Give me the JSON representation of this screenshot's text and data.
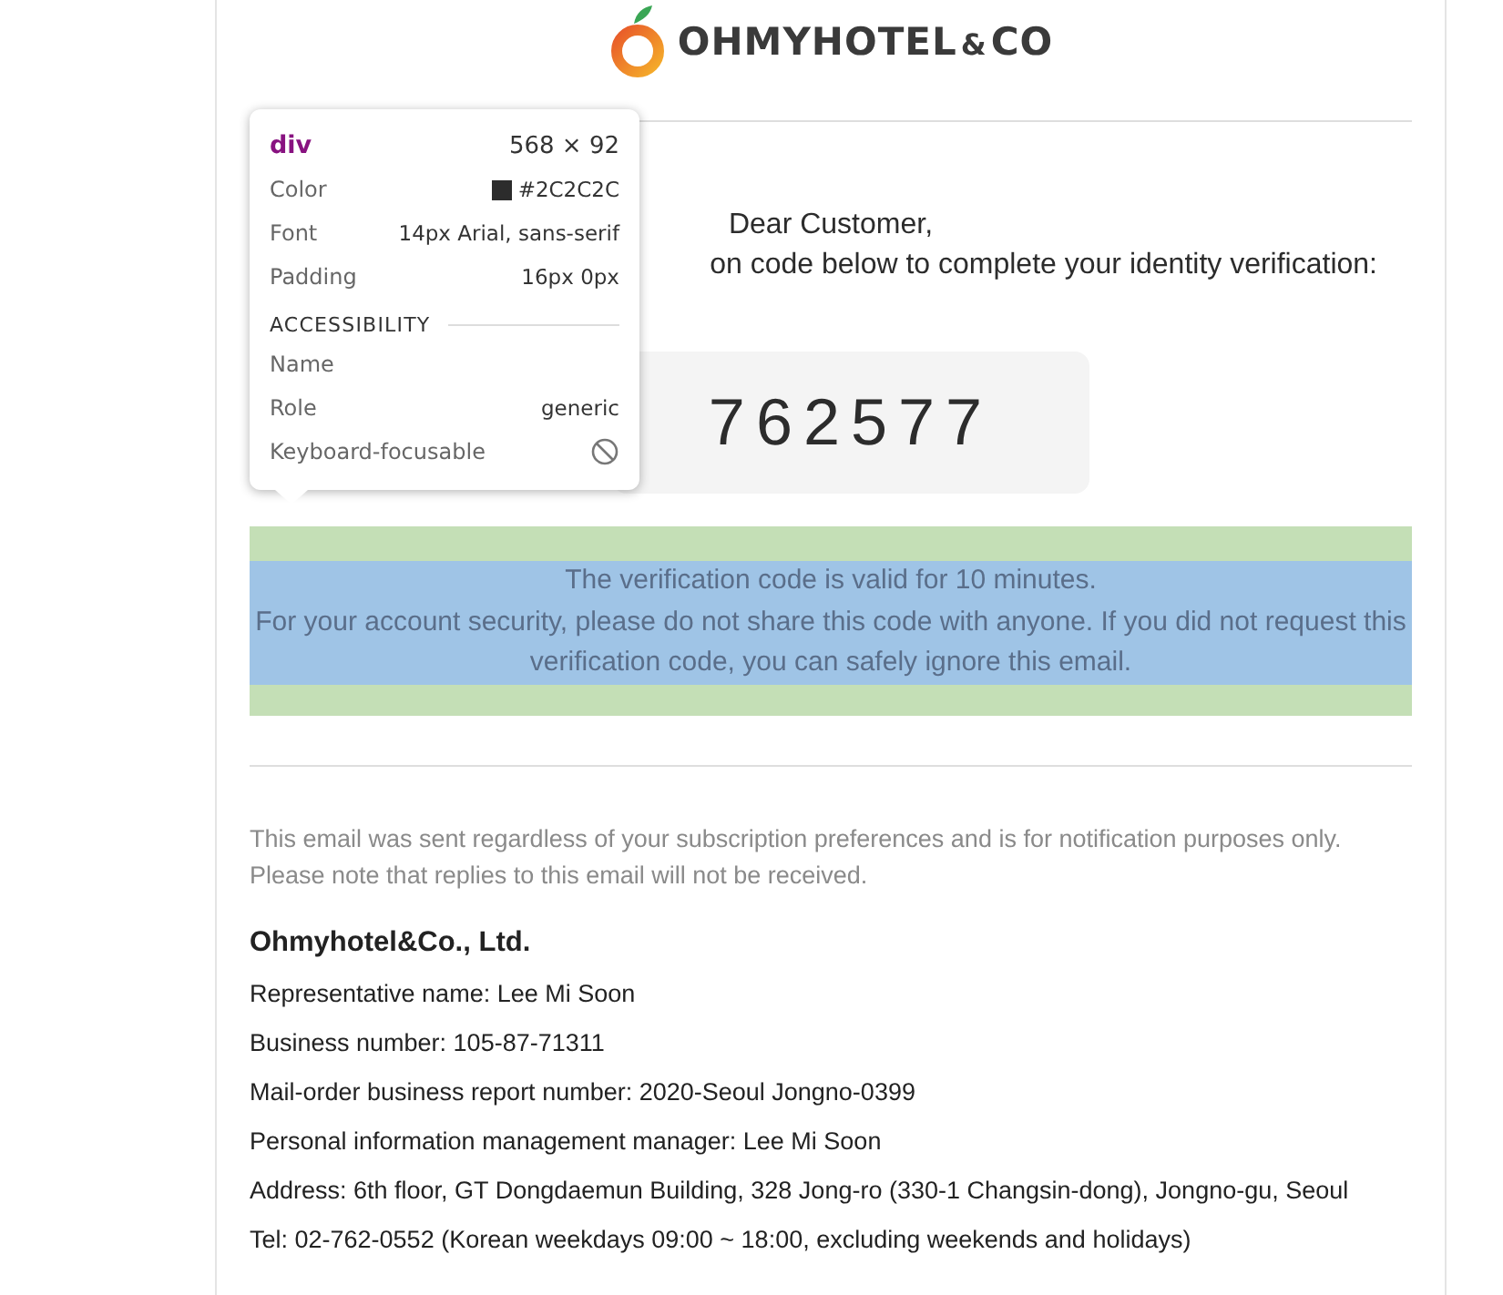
{
  "logo": {
    "brand": "OHMYHOTEL",
    "amp": "&",
    "suffix": "CO"
  },
  "greeting": {
    "salutation": "Dear Customer,",
    "instruction": "on code below to complete your identity verification:"
  },
  "code": "762577",
  "notice": [
    "The verification code is valid for 10 minutes.",
    "For your account security, please do not share this code with anyone. If you did not request this verification code, you can safely ignore this email."
  ],
  "inspect_overlay": {
    "tag": "div",
    "size": "568 × 92",
    "rows": [
      {
        "label": "Color",
        "value": "#2C2C2C",
        "color": "#2c2c2c"
      },
      {
        "label": "Font",
        "value": "14px Arial, sans-serif"
      },
      {
        "label": "Padding",
        "value": "16px 0px"
      }
    ],
    "section": "ACCESSIBILITY",
    "accessibility": [
      {
        "label": "Name",
        "kind": "text"
      },
      {
        "label": "Role",
        "value": "generic",
        "kind": "text"
      },
      {
        "label": "Keyboard-focusable",
        "kind": "blocked"
      }
    ]
  },
  "footer": {
    "disclaimer": [
      "This email was sent regardless of your subscription preferences and is for notification purposes only.",
      "Please note that replies to this email will not be received."
    ],
    "company": "Ohmyhotel&Co., Ltd.",
    "details": [
      "Representative name: Lee Mi Soon",
      "Business number: 105-87-71311",
      "Mail-order business report number: 2020-Seoul Jongno-0399",
      "Personal information management manager: Lee Mi Soon",
      "Address: 6th floor, GT Dongdaemun Building, 328 Jong-ro (330-1 Changsin-dong), Jongno-gu, Seoul",
      "Tel: 02-762-0552 (Korean weekdays 09:00 ~ 18:00, excluding weekends and holidays)"
    ]
  }
}
